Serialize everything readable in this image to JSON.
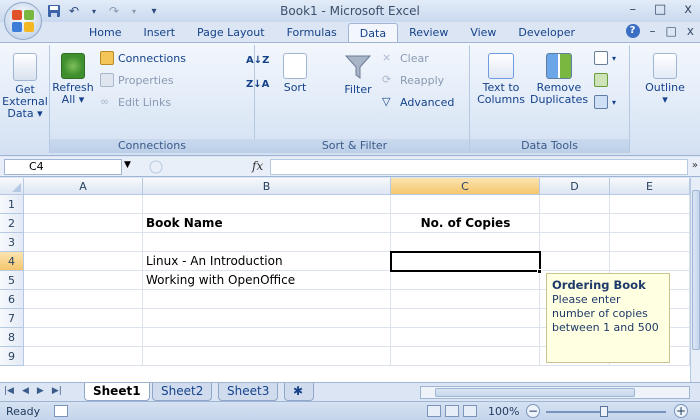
{
  "window": {
    "title": "Book1 - Microsoft Excel",
    "minimize": "–",
    "maximize": "□",
    "close": "x"
  },
  "ribbon_tabs": [
    "Home",
    "Insert",
    "Page Layout",
    "Formulas",
    "Data",
    "Review",
    "View",
    "Developer"
  ],
  "active_tab": "Data",
  "ribbon": {
    "get_external_data": [
      "Get External",
      "Data ▾"
    ],
    "refresh_all": [
      "Refresh",
      "All ▾"
    ],
    "connections_btn": "Connections",
    "properties_btn": "Properties",
    "edit_links_btn": "Edit Links",
    "connections_group": "Connections",
    "sort_btn": "Sort",
    "filter_btn": "Filter",
    "clear_btn": "Clear",
    "reapply_btn": "Reapply",
    "advanced_btn": "Advanced",
    "sort_filter_group": "Sort & Filter",
    "text_to_columns": [
      "Text to",
      "Columns"
    ],
    "remove_duplicates": [
      "Remove",
      "Duplicates"
    ],
    "data_tools_group": "Data Tools",
    "outline_btn": "Outline"
  },
  "formula_bar": {
    "name_box": "C4",
    "fx": "fx",
    "formula": ""
  },
  "columns": [
    "A",
    "B",
    "C",
    "D",
    "E"
  ],
  "rows": [
    "1",
    "2",
    "3",
    "4",
    "5",
    "6",
    "7",
    "8",
    "9"
  ],
  "cells": {
    "B2": "Book Name",
    "C2": "No. of Copies",
    "B4": "Linux - An Introduction",
    "B5": "Working with OpenOffice"
  },
  "tooltip": {
    "title": "Ordering Book",
    "body": [
      "Please enter",
      "number of copies",
      "between 1 and 500"
    ]
  },
  "sheets": [
    "Sheet1",
    "Sheet2",
    "Sheet3"
  ],
  "active_sheet": "Sheet1",
  "status": {
    "ready": "Ready",
    "zoom": "100%",
    "zoom_minus": "−",
    "zoom_plus": "+"
  },
  "colors": {
    "accent": "#15428b",
    "selected_header": "#f5c66c",
    "tooltip_bg": "#ffffe1"
  }
}
